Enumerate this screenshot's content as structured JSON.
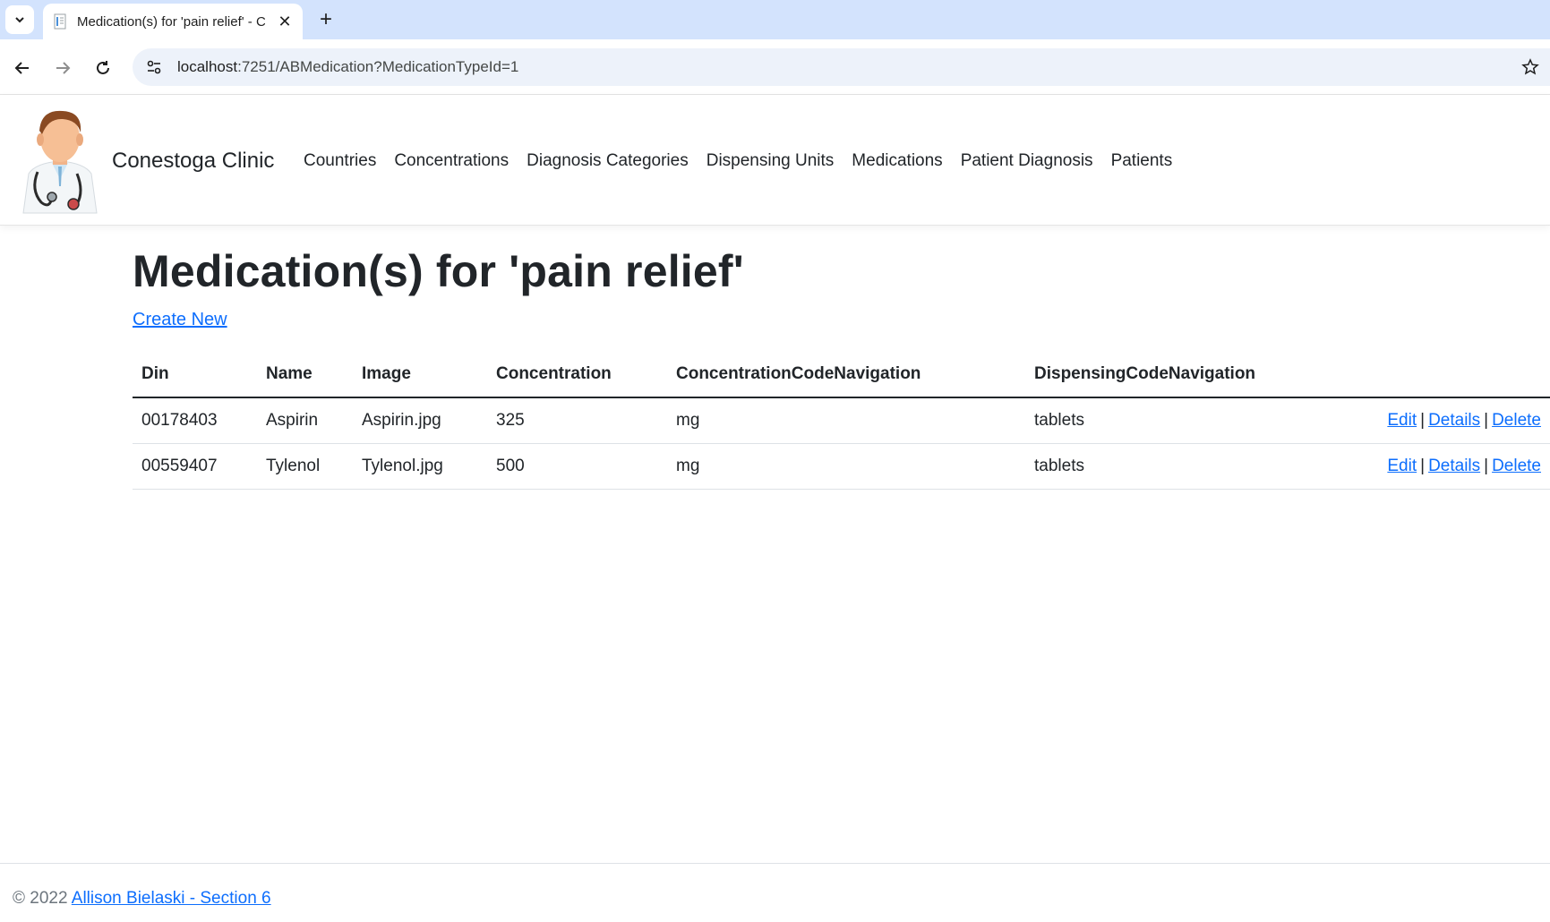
{
  "browser": {
    "tab_title": "Medication(s) for 'pain relief' - C",
    "url_host": "localhost",
    "url_path": ":7251/ABMedication?MedicationTypeId=1"
  },
  "nav": {
    "brand": "Conestoga Clinic",
    "links": [
      "Countries",
      "Concentrations",
      "Diagnosis Categories",
      "Dispensing Units",
      "Medications",
      "Patient Diagnosis",
      "Patients"
    ]
  },
  "main": {
    "title": "Medication(s) for 'pain relief'",
    "create_new": "Create New",
    "columns": [
      "Din",
      "Name",
      "Image",
      "Concentration",
      "ConcentrationCodeNavigation",
      "DispensingCodeNavigation"
    ],
    "rows": [
      {
        "din": "00178403",
        "name": "Aspirin",
        "image": "Aspirin.jpg",
        "concentration": "325",
        "concentration_code": "mg",
        "dispensing_code": "tablets"
      },
      {
        "din": "00559407",
        "name": "Tylenol",
        "image": "Tylenol.jpg",
        "concentration": "500",
        "concentration_code": "mg",
        "dispensing_code": "tablets"
      }
    ],
    "actions": {
      "edit": "Edit",
      "details": "Details",
      "delete": "Delete",
      "separator": "|"
    }
  },
  "footer": {
    "copyright": "© 2022",
    "link": "Allison Bielaski - Section 6"
  },
  "colors": {
    "link": "#0d6efd",
    "tabbar": "#d3e3fd",
    "omnibox": "#edf2fa"
  }
}
